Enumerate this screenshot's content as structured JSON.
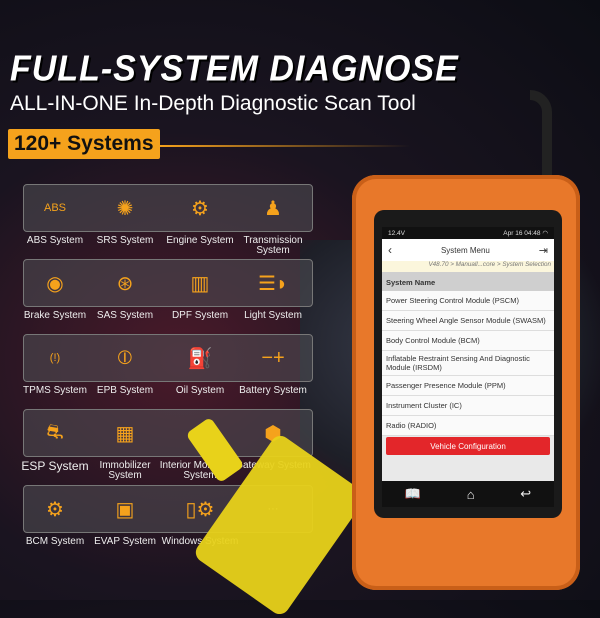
{
  "headline": "FULL-SYSTEM DIAGNOSE",
  "subheadline": "ALL-IN-ONE In-Depth Diagnostic Scan Tool",
  "badge": "120+ Systems",
  "accent": "#f5a21c",
  "systems": [
    {
      "label": "ABS System",
      "icon": "abs-icon",
      "glyph": "ABS"
    },
    {
      "label": "SRS System",
      "icon": "airbag-icon",
      "glyph": "✺"
    },
    {
      "label": "Engine System",
      "icon": "engine-icon",
      "glyph": "⚙"
    },
    {
      "label": "Transmission System",
      "icon": "gear-shift-icon",
      "glyph": "♟"
    },
    {
      "label": "Brake System",
      "icon": "brake-disc-icon",
      "glyph": "◉"
    },
    {
      "label": "SAS System",
      "icon": "steering-wheel-icon",
      "glyph": "⊛"
    },
    {
      "label": "DPF System",
      "icon": "dpf-filter-icon",
      "glyph": "▥"
    },
    {
      "label": "Light System",
      "icon": "headlight-icon",
      "glyph": "☰◗"
    },
    {
      "label": "TPMS System",
      "icon": "tire-pressure-icon",
      "glyph": "(!)"
    },
    {
      "label": "EPB System",
      "icon": "parking-brake-icon",
      "glyph": "⦶"
    },
    {
      "label": "Oil System",
      "icon": "oil-can-icon",
      "glyph": "⛽"
    },
    {
      "label": "Battery System",
      "icon": "battery-icon",
      "glyph": "−+"
    },
    {
      "label": "ESP System",
      "icon": "stability-control-icon",
      "glyph": "⛐"
    },
    {
      "label": "Immobilizer System",
      "icon": "immobilizer-icon",
      "glyph": "▦"
    },
    {
      "label": "Interior Monitoring System",
      "icon": "dome-camera-icon",
      "glyph": "◒"
    },
    {
      "label": "Gateway System",
      "icon": "gateway-icon",
      "glyph": "⬢"
    },
    {
      "label": "BCM System",
      "icon": "car-gear-icon",
      "glyph": "⚙"
    },
    {
      "label": "EVAP System",
      "icon": "chip-icon",
      "glyph": "▣"
    },
    {
      "label": "Windows System",
      "icon": "window-gear-icon",
      "glyph": "▯⚙"
    },
    {
      "label": "",
      "icon": "more-icon",
      "glyph": "···"
    }
  ],
  "device": {
    "status": {
      "voltage": "12.4V",
      "datetime": "Apr 16 04:48"
    },
    "header": {
      "title": "System Menu"
    },
    "breadcrumb": "V48.70 > Manuall...core > System Selection",
    "column_header": "System Name",
    "rows": [
      "Power Steering Control Module (PSCM)",
      "Steering Wheel Angle Sensor Module (SWASM)",
      "Body Control Module (BCM)",
      "Inflatable Restraint Sensing And Diagnostic Module (IRSDM)",
      "Passenger Presence Module (PPM)",
      "Instrument Cluster (IC)",
      "Radio (RADIO)"
    ],
    "button": "Vehicle Configuration",
    "button_color": "#e3262a"
  }
}
